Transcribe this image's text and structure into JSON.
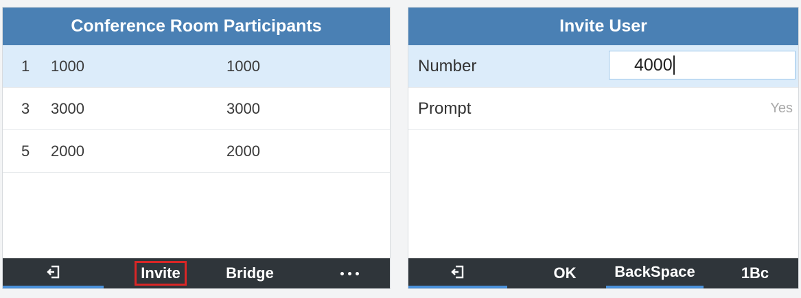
{
  "left_screen": {
    "title": "Conference Room Participants",
    "participants": [
      {
        "index": "1",
        "number": "1000",
        "name": "1000"
      },
      {
        "index": "3",
        "number": "3000",
        "name": "3000"
      },
      {
        "index": "5",
        "number": "2000",
        "name": "2000"
      }
    ],
    "softkeys": {
      "exit_icon": "exit-icon",
      "invite_label": "Invite",
      "bridge_label": "Bridge",
      "more_icon": "more-icon"
    }
  },
  "right_screen": {
    "title": "Invite User",
    "number_label": "Number",
    "number_value": "4000",
    "prompt_label": "Prompt",
    "prompt_value": "Yes",
    "softkeys": {
      "exit_icon": "exit-icon",
      "ok_label": "OK",
      "backspace_label": "BackSpace",
      "input_mode_label": "1Bc"
    }
  },
  "colors": {
    "title_bar": "#4a80b4",
    "softkey_bar": "#2f353a",
    "selected_row": "#dcecfa",
    "highlight_box": "#d92626",
    "active_indicator": "#4a90d9"
  }
}
